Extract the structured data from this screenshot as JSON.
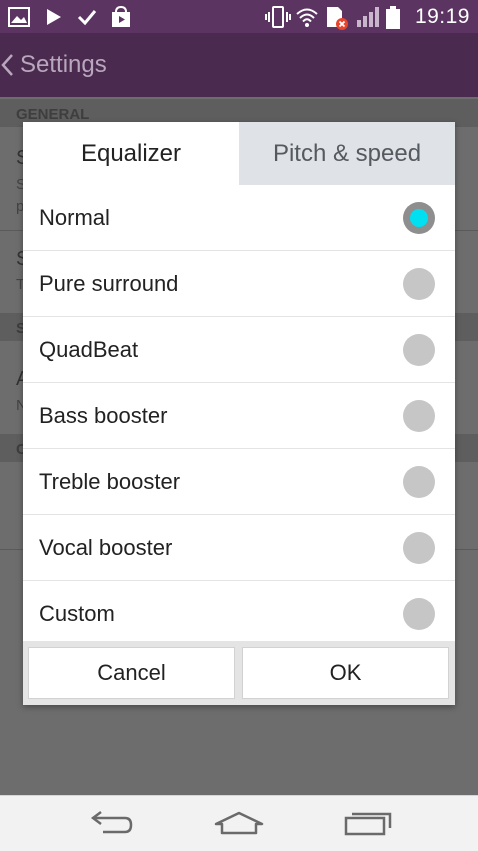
{
  "status_bar": {
    "time": "19:19",
    "left_icons": [
      "gallery-icon",
      "play-icon",
      "check-icon",
      "store-icon"
    ],
    "right_icons": [
      "vibrate-icon",
      "wifi-icon",
      "sim-error-icon",
      "signal-icon",
      "battery-icon"
    ]
  },
  "app_bar": {
    "title": "Settings"
  },
  "background": {
    "section_general": "GENERAL",
    "fragments": [
      "S",
      "S",
      "p",
      "S",
      "T",
      "S",
      "A",
      "N",
      "C"
    ]
  },
  "dialog": {
    "tabs": [
      {
        "label": "Equalizer",
        "active": true
      },
      {
        "label": "Pitch & speed",
        "active": false
      }
    ],
    "options": [
      {
        "label": "Normal",
        "selected": true
      },
      {
        "label": "Pure surround",
        "selected": false
      },
      {
        "label": "QuadBeat",
        "selected": false
      },
      {
        "label": "Bass booster",
        "selected": false
      },
      {
        "label": "Treble booster",
        "selected": false
      },
      {
        "label": "Vocal booster",
        "selected": false
      },
      {
        "label": "Custom",
        "selected": false
      }
    ],
    "cancel_label": "Cancel",
    "ok_label": "OK"
  },
  "nav_bar": {
    "icons": [
      "back-icon",
      "home-icon",
      "recent-apps-icon"
    ]
  },
  "colors": {
    "status_bar": "#5b3461",
    "app_bar": "#4a2b4f",
    "radio_selected": "#00e0f0",
    "tab_inactive": "#dfe2e6"
  }
}
